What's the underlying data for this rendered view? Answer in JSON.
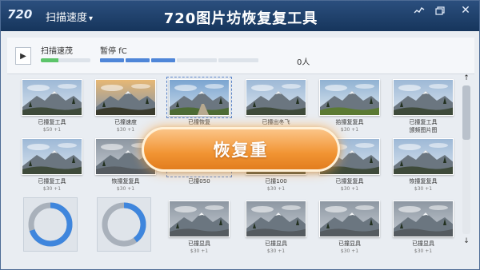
{
  "app": {
    "logo": "720",
    "menu_label": "扫描速度",
    "title": "720图片坊恢复复工具"
  },
  "window_controls": {
    "chart_icon": "chart-icon",
    "restore_icon": "window-restore-icon",
    "close_icon": "close-icon"
  },
  "toolbar": {
    "scan_label": "扫描速茂",
    "status_label": "暂停 fC",
    "count_label": "0人",
    "scan_progress": 0.35,
    "status_segments_on": 3,
    "status_segments_total": 5
  },
  "thumbnails": [
    {
      "caption": "已撞复工具",
      "sub": "$50 +1",
      "selected": false,
      "tone": "blue"
    },
    {
      "caption": "已撞速度",
      "sub": "$30 +1",
      "selected": false,
      "tone": "sunset"
    },
    {
      "caption": "已撞恢复",
      "sub": "$50 +0",
      "selected": true,
      "tone": "road"
    },
    {
      "caption": "已撞出冬飞",
      "sub": "$50 +1",
      "selected": false,
      "tone": "blue"
    },
    {
      "caption": "拾撞复复具",
      "sub": "$30 +1",
      "selected": false,
      "tone": "green"
    },
    {
      "caption": "已撞复工具",
      "sub": "",
      "caption2": "颁频图片图",
      "selected": false,
      "tone": "blue"
    },
    {
      "caption": "已撞复工具",
      "sub": "$30 +1",
      "selected": false,
      "tone": "blue"
    },
    {
      "caption": "恢撞复复具",
      "sub": "$30 +1",
      "selected": false,
      "tone": "grey"
    },
    {
      "caption": "已撞050",
      "sub": "",
      "selected": true,
      "tone": "none"
    },
    {
      "caption": "已撞100",
      "sub": "$30 +1",
      "selected": false,
      "tone": "blue"
    },
    {
      "caption": "已撞复复具",
      "sub": "$30 +1",
      "selected": false,
      "tone": "blue"
    },
    {
      "caption": "恢撞复复具",
      "sub": "$30 +1",
      "selected": false,
      "tone": "blue"
    },
    {
      "caption": "已撞显具",
      "sub": "$30 +1",
      "selected": false,
      "tone": "grey"
    },
    {
      "caption": "已撞显具",
      "sub": "$30 +1",
      "selected": false,
      "tone": "grey"
    },
    {
      "caption": "已撞显具",
      "sub": "$30 +1",
      "selected": false,
      "tone": "grey"
    },
    {
      "caption": "已撞显具",
      "sub": "$30 +1",
      "selected": false,
      "tone": "grey"
    }
  ],
  "ring_progress": [
    0.7,
    0.4
  ],
  "restore_button": {
    "label": "恢复重"
  },
  "scrollbar": {
    "up": "↑",
    "down": "↓"
  }
}
